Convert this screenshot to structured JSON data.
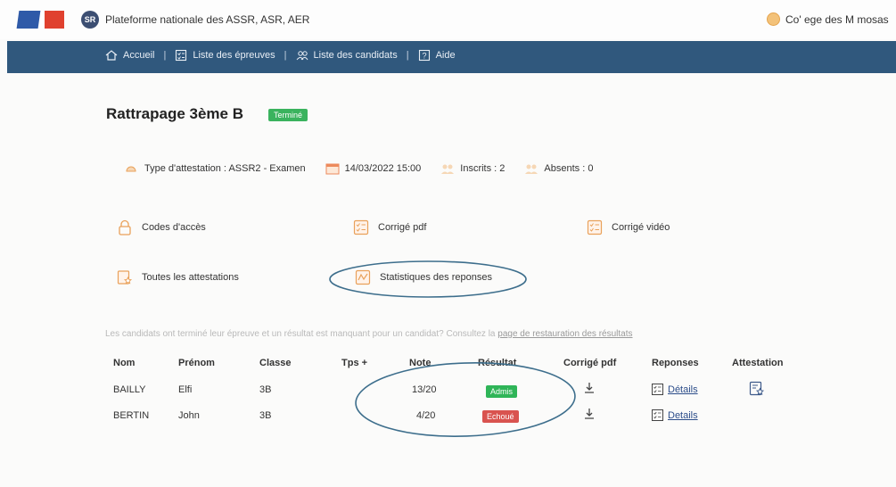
{
  "header": {
    "platform_title": "Plateforme nationale des ASSR, ASR, AER",
    "logo_text": "SR",
    "college": "Co' ege des M mosas"
  },
  "nav": {
    "items": [
      {
        "label": "Accueil",
        "icon": "home-icon"
      },
      {
        "label": "Liste des épreuves",
        "icon": "checklist-icon"
      },
      {
        "label": "Liste des candidats",
        "icon": "users-icon"
      },
      {
        "label": "Aide",
        "icon": "help-icon"
      }
    ],
    "separator": "|"
  },
  "exam": {
    "title": "Rattrapage 3ème B",
    "status": "Terminé",
    "meta": {
      "type": "Type d'attestation : ASSR2 - Examen",
      "date": "14/03/2022 15:00",
      "inscrits": "Inscrits : 2",
      "absents": "Absents : 0"
    }
  },
  "actions": {
    "codes": "Codes d'accès",
    "corrige_pdf": "Corrigé pdf",
    "corrige_video": "Corrigé vidéo",
    "attestations": "Toutes les attestations",
    "statistiques": "Statistiques des reponses"
  },
  "notice": {
    "text": "Les candidats ont terminé leur épreuve et un résultat est manquant pour un candidat? Consultez la",
    "link": "page de restauration des résultats"
  },
  "table": {
    "headers": [
      "Nom",
      "Prénom",
      "Classe",
      "Tps +",
      "Note",
      "Résultat",
      "Corrigé pdf",
      "Reponses",
      "Attestation"
    ],
    "rows": [
      {
        "nom": "BAILLY",
        "prenom": "Elfi",
        "classe": "3B",
        "note": "13/20",
        "resultat": "Admis",
        "detail": "Détails"
      },
      {
        "nom": "BERTIN",
        "prenom": "John",
        "classe": "3B",
        "note": "4/20",
        "resultat": "Echoué",
        "detail": "Details"
      }
    ]
  },
  "colors": {
    "nav_bg": "#30587d",
    "accent_orange": "#e9a15a",
    "admis": "#2fb558",
    "echoue": "#d9534f",
    "ellipse": "#3d6e8c"
  }
}
